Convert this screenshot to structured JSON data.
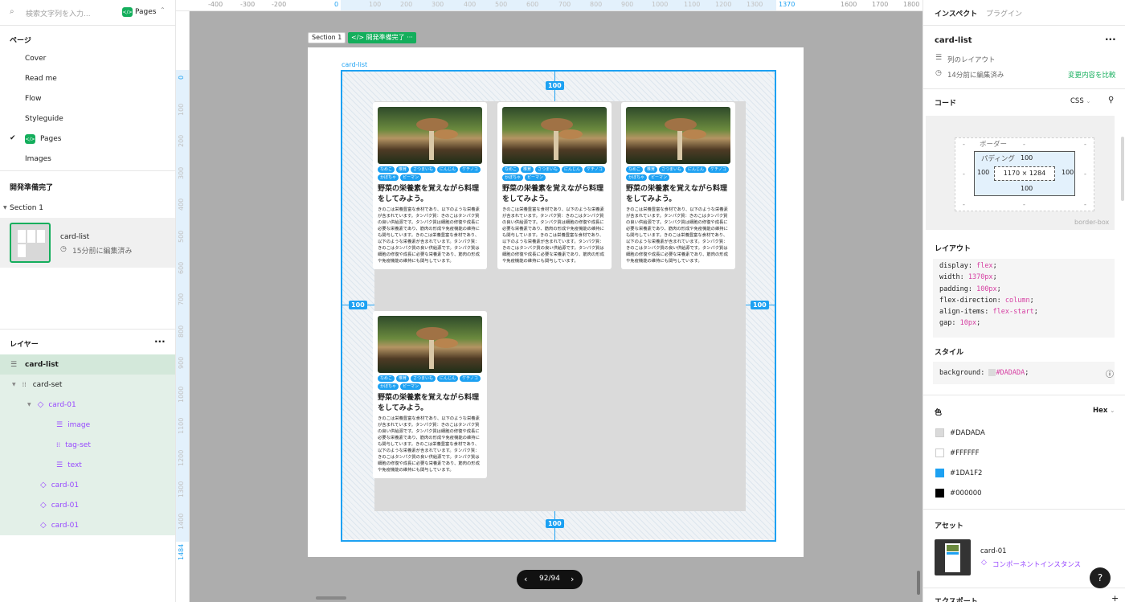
{
  "left": {
    "search_placeholder": "検索文字列を入力...",
    "current_page_badge": "Pages",
    "pages_heading": "ページ",
    "pages": [
      "Cover",
      "Read me",
      "Flow",
      "Styleguide",
      "Pages",
      "Images"
    ],
    "active_page": "Pages",
    "ready_heading": "開発準備完了",
    "section_label": "Section 1",
    "thumb_title": "card-list",
    "thumb_edited": "15分前に編集済み",
    "layers_heading": "レイヤー",
    "layers": [
      {
        "name": "card-list",
        "type": "frame"
      },
      {
        "name": "card-set",
        "type": "grid"
      },
      {
        "name": "card-01",
        "type": "component"
      },
      {
        "name": "image",
        "type": "text-lines"
      },
      {
        "name": "tag-set",
        "type": "grid"
      },
      {
        "name": "text",
        "type": "text-lines"
      },
      {
        "name": "card-01",
        "type": "component"
      },
      {
        "name": "card-01",
        "type": "component"
      },
      {
        "name": "card-01",
        "type": "component"
      }
    ]
  },
  "canvas": {
    "ruler_top": [
      "-400",
      "-300",
      "-200",
      "0",
      "100",
      "200",
      "300",
      "400",
      "500",
      "600",
      "700",
      "800",
      "900",
      "1000",
      "1100",
      "1200",
      "1300",
      "1370",
      "1600",
      "1700",
      "1800"
    ],
    "ruler_left": [
      "0",
      "100",
      "200",
      "300",
      "400",
      "500",
      "600",
      "700",
      "800",
      "900",
      "1000",
      "1100",
      "1200",
      "1300",
      "1400",
      "1484"
    ],
    "section_label": "Section 1",
    "ready_badge": "開発準備完了",
    "frame_label": "card-list",
    "padding_value": "100",
    "cards": [
      {
        "tags": [
          "なめこ",
          "椎茸",
          "さつまいも",
          "にんじん",
          "ケチノコ",
          "かぼちゃ",
          "ピーマン"
        ],
        "title": "野菜の栄養素を覚えながら料理をしてみよう。",
        "text": "きのこは栄養豊富な食材であり、以下のような栄養素が含まれています。タンパク質：きのこはタンパク質の良い供給源です。タンパク質は細胞の修復や成長に必要な栄養素であり、筋肉の形成や免疫機能の維持にも関与しています。きのこは栄養豊富な食材であり、以下のような栄養素が含まれています。タンパク質：きのこはタンパク質の良い供給源です。タンパク質は細胞の修復や成長に必要な栄養素であり、筋肉の形成や免疫機能の維持にも関与しています。"
      },
      {
        "tags": [
          "なめこ",
          "椎茸",
          "さつまいも",
          "にんじん",
          "ケチノコ",
          "かぼちゃ",
          "ピーマン"
        ],
        "title": "野菜の栄養素を覚えながら料理をしてみよう。",
        "text": "きのこは栄養豊富な食材であり、以下のような栄養素が含まれています。タンパク質：きのこはタンパク質の良い供給源です。タンパク質は細胞の修復や成長に必要な栄養素であり、筋肉の形成や免疫機能の維持にも関与しています。きのこは栄養豊富な食材であり、以下のような栄養素が含まれています。タンパク質：きのこはタンパク質の良い供給源です。タンパク質は細胞の修復や成長に必要な栄養素であり、筋肉の形成や免疫機能の維持にも関与しています。"
      },
      {
        "tags": [
          "なめこ",
          "椎茸",
          "さつまいも",
          "にんじん",
          "ケチノコ",
          "かぼちゃ",
          "ピーマン"
        ],
        "title": "野菜の栄養素を覚えながら料理をしてみよう。",
        "text": "きのこは栄養豊富な食材であり、以下のような栄養素が含まれています。タンパク質：きのこはタンパク質の良い供給源です。タンパク質は細胞の修復や成長に必要な栄養素であり、筋肉の形成や免疫機能の維持にも関与しています。きのこは栄養豊富な食材であり、以下のような栄養素が含まれています。タンパク質：きのこはタンパク質の良い供給源です。タンパク質は細胞の修復や成長に必要な栄養素であり、筋肉の形成や免疫機能の維持にも関与しています。"
      },
      {
        "tags": [
          "なめこ",
          "椎茸",
          "さつまいも",
          "にんじん",
          "ケチノコ",
          "かぼちゃ",
          "ピーマン"
        ],
        "title": "野菜の栄養素を覚えながら料理をしてみよう。",
        "text": "きのこは栄養豊富な食材であり、以下のような栄養素が含まれています。タンパク質：きのこはタンパク質の良い供給源です。タンパク質は細胞の修復や成長に必要な栄養素であり、筋肉の形成や免疫機能の維持にも関与しています。きのこは栄養豊富な食材であり、以下のような栄養素が含まれています。タンパク質：きのこはタンパク質の良い供給源です。タンパク質は細胞の修復や成長に必要な栄養素であり、筋肉の形成や免疫機能の維持にも関与しています。"
      }
    ],
    "pager": "92/94"
  },
  "right": {
    "tab_inspect": "インスペクト",
    "tab_plugin": "プラグイン",
    "element_name": "card-list",
    "layout_type": "列のレイアウト",
    "edited": "14分前に編集済み",
    "compare_link": "変更内容を比較",
    "code_heading": "コード",
    "code_lang": "CSS",
    "box": {
      "border_label": "ボーダー",
      "padding_label": "パディング",
      "dash": "-",
      "pad_top": "100",
      "pad_left": "100",
      "pad_right": "100",
      "pad_bottom": "100",
      "size": "1170 × 1284",
      "box_sizing": "border-box"
    },
    "layout_heading": "レイアウト",
    "layout_code": [
      {
        "prop": "display",
        "value": "flex"
      },
      {
        "prop": "width",
        "value": "1370px"
      },
      {
        "prop": "padding",
        "value": "100px"
      },
      {
        "prop": "flex-direction",
        "value": "column"
      },
      {
        "prop": "align-items",
        "value": "flex-start"
      },
      {
        "prop": "gap",
        "value": "10px"
      }
    ],
    "style_heading": "スタイル",
    "style_prop": "background",
    "style_value": "#DADADA",
    "color_heading": "色",
    "color_format": "Hex",
    "colors": [
      "#DADADA",
      "#FFFFFF",
      "#1DA1F2",
      "#000000"
    ],
    "assets_heading": "アセット",
    "asset_name": "card-01",
    "asset_type": "コンポーネントインスタンス",
    "export_heading": "エクスポート",
    "help": "?"
  }
}
